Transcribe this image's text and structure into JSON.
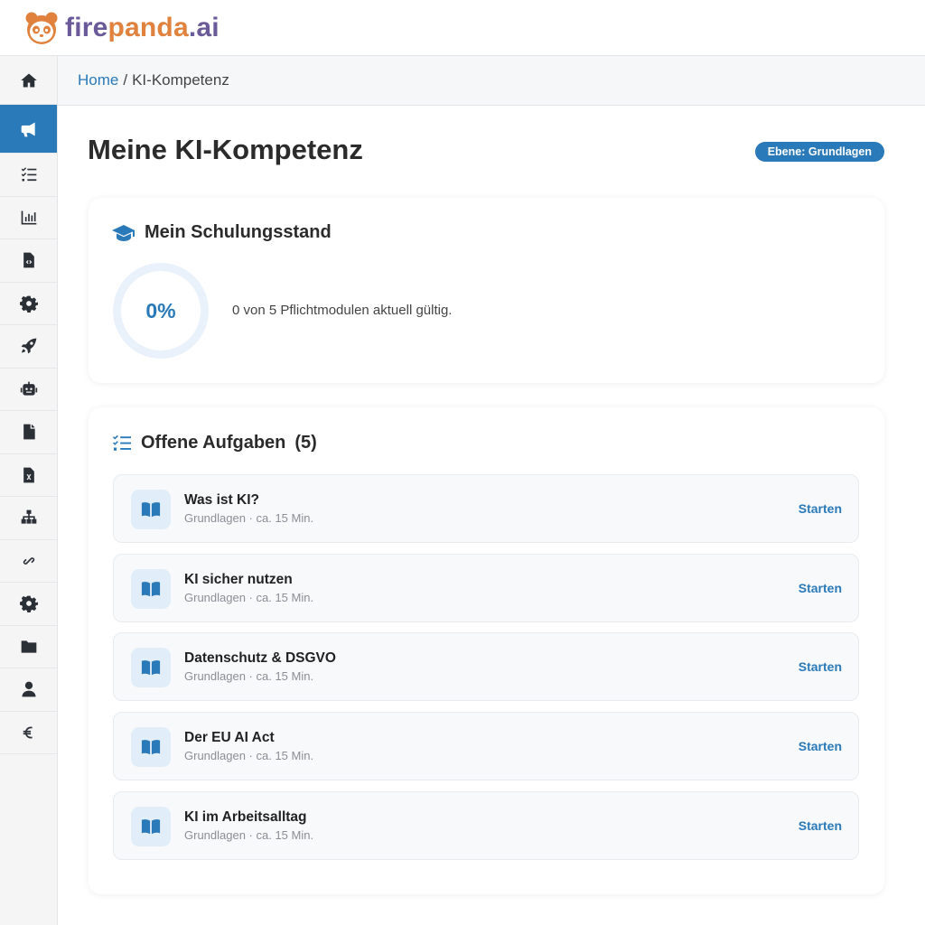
{
  "brand": {
    "part1": "fire",
    "part2": "panda",
    "part3": ".ai"
  },
  "breadcrumb": {
    "home": "Home",
    "separator": "/",
    "current": "KI-Kompetenz"
  },
  "page": {
    "title": "Meine KI-Kompetenz",
    "level_badge": "Ebene: Grundlagen"
  },
  "status_card": {
    "title": "Mein Schulungsstand",
    "progress_percent": 0,
    "progress_label": "0%",
    "progress_text": "0 von 5 Pflichtmodulen aktuell gültig."
  },
  "tasks_card": {
    "title": "Offene Aufgaben",
    "count": "(5)",
    "items": [
      {
        "name": "Was ist KI?",
        "meta": "Grundlagen · ca. 15 Min.",
        "action": "Starten"
      },
      {
        "name": "KI sicher nutzen",
        "meta": "Grundlagen · ca. 15 Min.",
        "action": "Starten"
      },
      {
        "name": "Datenschutz & DSGVO",
        "meta": "Grundlagen · ca. 15 Min.",
        "action": "Starten"
      },
      {
        "name": "Der EU AI Act",
        "meta": "Grundlagen · ca. 15 Min.",
        "action": "Starten"
      },
      {
        "name": "KI im Arbeitsalltag",
        "meta": "Grundlagen · ca. 15 Min.",
        "action": "Starten"
      }
    ]
  },
  "sidebar": {
    "items": [
      {
        "icon": "home-icon"
      },
      {
        "icon": "megaphone-icon",
        "active": true
      },
      {
        "icon": "task-list-icon"
      },
      {
        "icon": "bar-chart-icon"
      },
      {
        "icon": "code-file-icon"
      },
      {
        "icon": "gear-icon"
      },
      {
        "icon": "rocket-icon"
      },
      {
        "icon": "robot-icon"
      },
      {
        "icon": "file-icon"
      },
      {
        "icon": "excel-file-icon"
      },
      {
        "icon": "sitemap-icon"
      },
      {
        "icon": "link-icon"
      },
      {
        "icon": "gear-icon"
      },
      {
        "icon": "folder-icon"
      },
      {
        "icon": "user-icon"
      },
      {
        "icon": "euro-icon"
      }
    ]
  },
  "colors": {
    "accent": "#2a79b9",
    "brand_purple": "#6a5a9a",
    "brand_orange": "#e0813d"
  }
}
